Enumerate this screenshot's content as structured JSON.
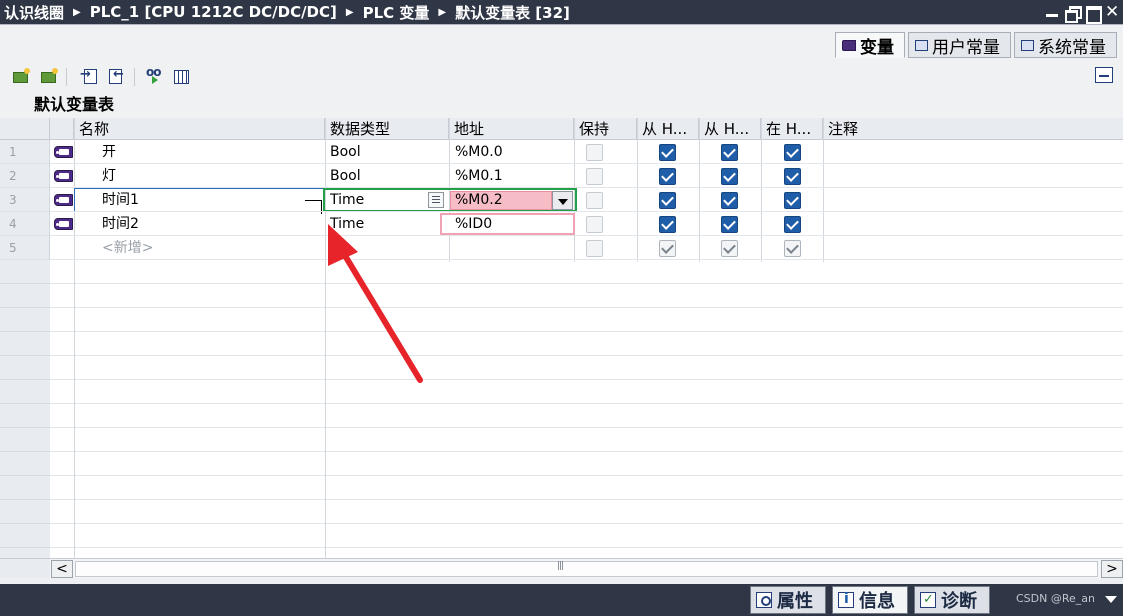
{
  "titlebar": {
    "crumbs": [
      "认识线圈",
      "PLC_1 [CPU 1212C DC/DC/DC]",
      "PLC 变量",
      "默认变量表 [32]"
    ]
  },
  "tabs": [
    {
      "label": "变量",
      "icon": "tag-icon",
      "active": true
    },
    {
      "label": "用户常量",
      "icon": "user-constant-icon",
      "active": false
    },
    {
      "label": "系统常量",
      "icon": "system-constant-icon",
      "active": false
    }
  ],
  "grid": {
    "title": "默认变量表",
    "columns": [
      "名称",
      "数据类型",
      "地址",
      "保持",
      "从 H...",
      "从 H...",
      "在 H...",
      "注释"
    ]
  },
  "rows": [
    {
      "num": "1",
      "name": "开",
      "type": "Bool",
      "addr": "%M0.0"
    },
    {
      "num": "2",
      "name": "灯",
      "type": "Bool",
      "addr": "%M0.1"
    },
    {
      "num": "3",
      "name": "时间1",
      "type": "Time",
      "addr": "%M0.2"
    },
    {
      "num": "4",
      "name": "时间2",
      "type": "Time",
      "addr": "%ID0"
    },
    {
      "num": "5",
      "name": "<新增>",
      "type": "",
      "addr": ""
    }
  ],
  "bottom_tabs": [
    {
      "label": "属性",
      "icon": "properties-icon"
    },
    {
      "label": "信息",
      "icon": "info-icon"
    },
    {
      "label": "诊断",
      "icon": "diagnostics-icon"
    }
  ],
  "watermark": "CSDN @Re_an",
  "colors": {
    "titlebar": "#2f3645",
    "checkbox_checked": "#1f5da8",
    "highlight_green": "#24a04a",
    "highlight_pink": "#f7bdc6",
    "annotation_arrow": "#e8242b"
  }
}
